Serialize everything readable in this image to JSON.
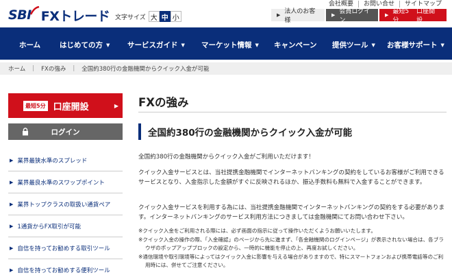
{
  "header": {
    "logo_sbi": "SBI",
    "logo_fx": "FXトレード",
    "font_size_label": "文字サイズ",
    "font_sizes": [
      "大",
      "中",
      "小"
    ],
    "top_links": [
      "会社概要",
      "お問い合せ",
      "サイトマップ"
    ],
    "buttons": {
      "corporate": "法人のお客様",
      "login": "会員ログイン",
      "open_tag": "最短5分",
      "open_label": "口座開設"
    }
  },
  "nav": {
    "items": [
      "ホーム",
      "はじめての方",
      "サービスガイド",
      "マーケット情報",
      "キャンペーン",
      "提供ツール",
      "お客様サポート"
    ]
  },
  "breadcrumb": [
    "ホーム",
    "FXの強み",
    "全国約380行の金融機関からクイック入金が可能"
  ],
  "sidebar": {
    "open_tag": "最短5分",
    "open_label": "口座開設",
    "login_label": "ログイン",
    "items": [
      "業界最狭水準のスプレッド",
      "業界最良水準のスワップポイント",
      "業界トップクラスの取扱い通貨ペア",
      "1通貨からFX取引が可能",
      "自信を持ってお勧めする取引ツール",
      "自信を持ってお勧めする便利ツール"
    ]
  },
  "main": {
    "page_title": "FXの強み",
    "section_title": "全国約380行の金融機関からクイック入金が可能",
    "paragraphs": [
      "全国約380行の金融機関からクイック入金がご利用いただけます！",
      "クイック入金サービスとは、当社提携金融機関でインターネットバンキングの契約をしているお客様がご利用できるサービスとなり、入金指示した金額がすぐに反映されるほか、振込手数料も無料で入金することができます。",
      "クイック入金サービスを利用する為には、当社提携金融機関でインターネットバンキングの契約をする必要があります。インターネットバンキングのサービス利用方法につきましては金融機関にてお問い合わせ下さい。"
    ],
    "notes": [
      "※クイック入金をご利用される際には、必ず画面の指示に従って操作いただくようお願いいたします。",
      "※クイック入金の操作の際、「入金確認」のページから先に進まず、「各金融機関のログインページ」が表示されない場合は、各ブラウザのポップアップブロックの設定から、一時的に機能を停止の上、再度お試しください。",
      "※通信環境や取引環境等によってはクイック入金に影響を与える場合がありますので、特にスマートフォンおよび携帯電話等のご利用時には、併せてご注意ください。"
    ]
  },
  "colors": {
    "brand_navy": "#0a2e7a",
    "accent_red": "#d0101b",
    "login_gray": "#666666"
  }
}
